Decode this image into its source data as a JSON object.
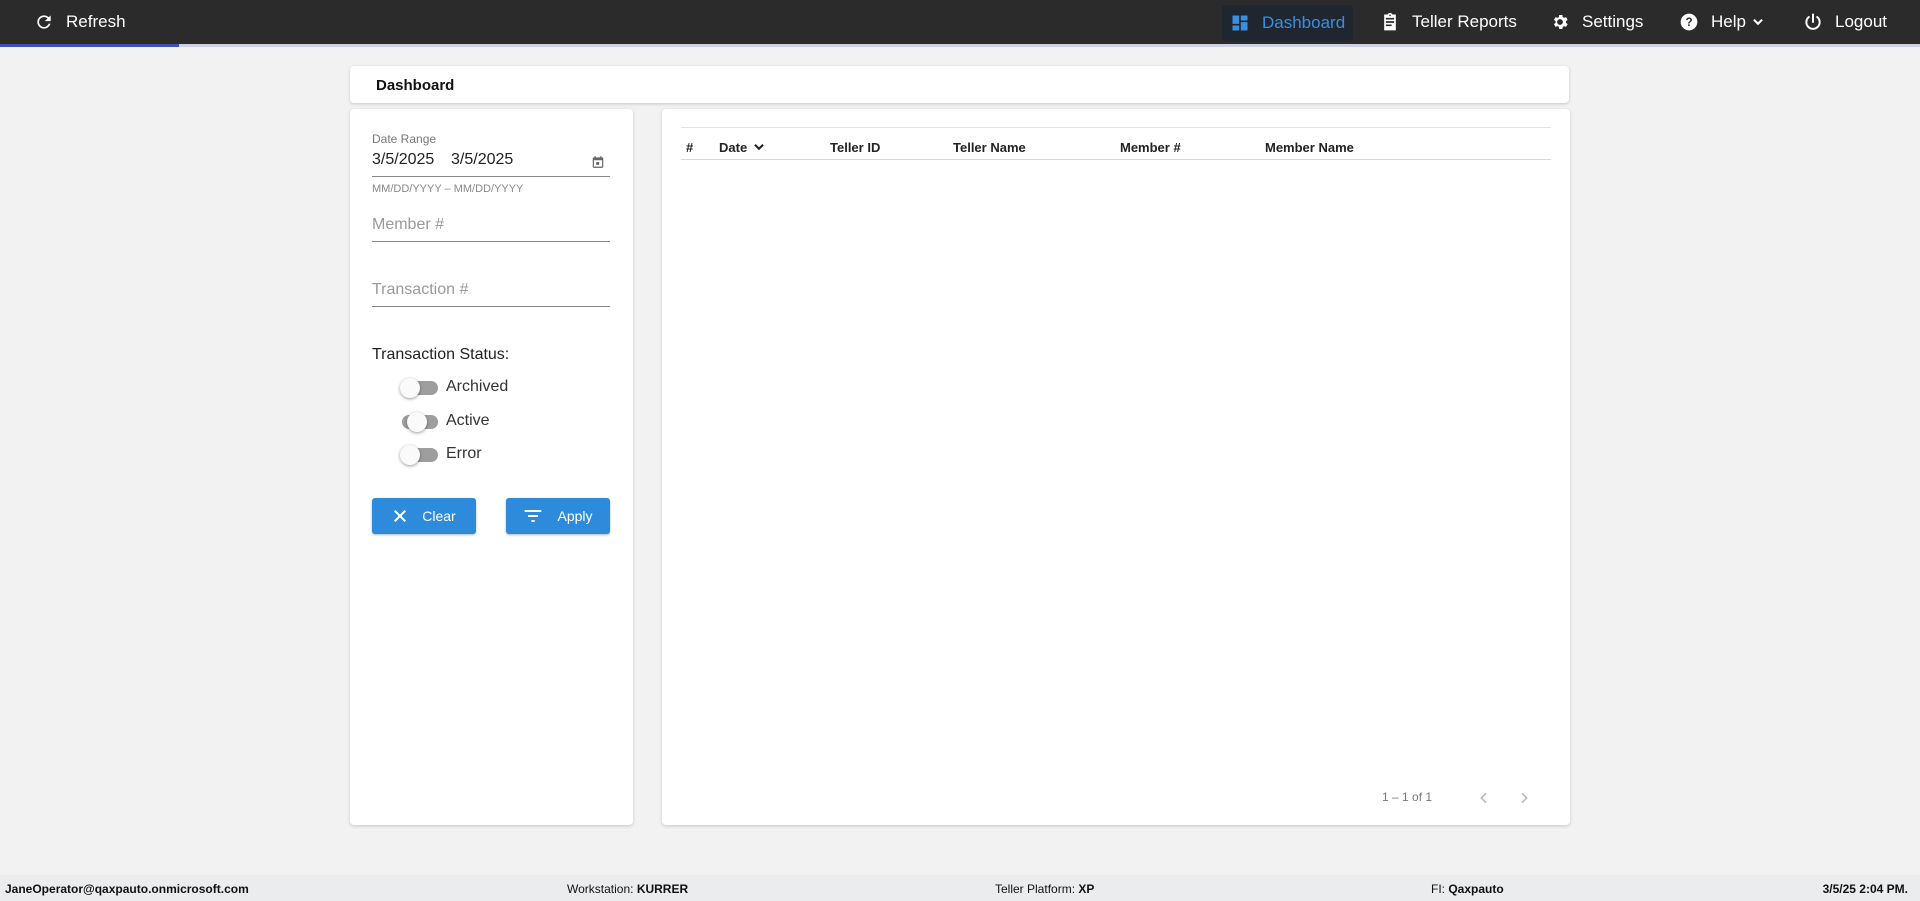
{
  "topbar": {
    "refresh_label": "Refresh",
    "nav": [
      {
        "label": "Dashboard",
        "icon": "dashboard-icon",
        "active": true
      },
      {
        "label": "Teller Reports",
        "icon": "clipboard-icon"
      },
      {
        "label": "Settings",
        "icon": "gear-icon"
      },
      {
        "label": "Help",
        "icon": "help-circle-icon"
      },
      {
        "label": "Logout",
        "icon": "power-icon"
      }
    ],
    "accent": "#3a8fe0"
  },
  "page": {
    "title": "Dashboard"
  },
  "filters": {
    "date_range_label": "Date Range",
    "start_date": "3/5/2025",
    "end_date": "3/5/2025",
    "date_hint": "MM/DD/YYYY – MM/DD/YYYY",
    "member_placeholder": "Member #",
    "transaction_placeholder": "Transaction #",
    "status_label": "Transaction Status:",
    "statuses": [
      {
        "label": "Archived",
        "on": false
      },
      {
        "label": "Active",
        "on": false
      },
      {
        "label": "Error",
        "on": false
      }
    ],
    "clear_label": "Clear",
    "apply_label": "Apply",
    "button_color": "#2e8bdc"
  },
  "table": {
    "columns": [
      "#",
      "Date",
      "Teller ID",
      "Teller Name",
      "Member #",
      "Member Name"
    ],
    "rows": [],
    "pagination": "1 – 1 of 1"
  },
  "footer": {
    "user": "JaneOperator@qaxpauto.onmicrosoft.com",
    "workstation_label": "Workstation:",
    "workstation": "KURRER",
    "platform_label": "Teller Platform:",
    "platform": "XP",
    "fi_label": "FI:",
    "fi": "Qaxpauto",
    "datetime": "3/5/25 2:04 PM."
  }
}
